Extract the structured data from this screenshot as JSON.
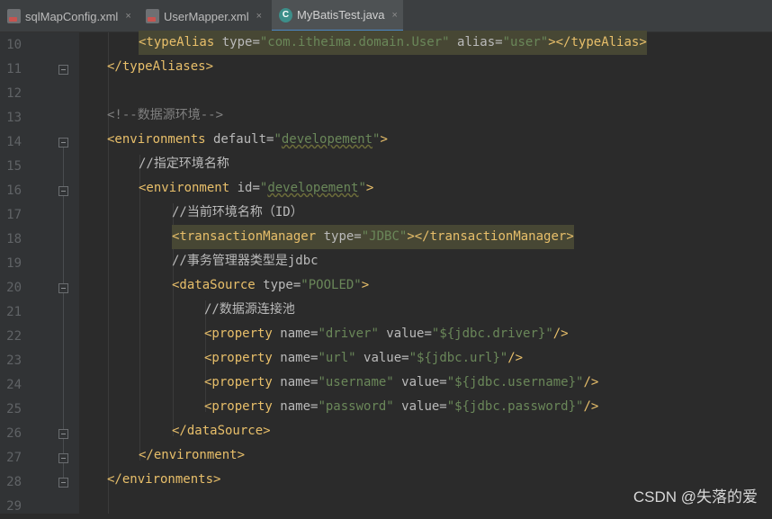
{
  "tabs": [
    {
      "label": "sqlMapConfig.xml",
      "icon": "xml-file-icon",
      "active": false
    },
    {
      "label": "UserMapper.xml",
      "icon": "xml-file-icon",
      "active": false
    },
    {
      "label": "MyBatisTest.java",
      "icon": "java-class-icon",
      "active": true
    }
  ],
  "close_glyph": "×",
  "line_numbers": [
    "10",
    "11",
    "12",
    "13",
    "14",
    "15",
    "16",
    "17",
    "18",
    "19",
    "20",
    "21",
    "22",
    "23",
    "24",
    "25",
    "26",
    "27",
    "28",
    "29"
  ],
  "code": {
    "l10": {
      "a": "<typeAlias",
      "b": " type=",
      "c": "\"com.itheima.domain.User\"",
      "d": " alias=",
      "e": "\"user\"",
      "f": "></typeAlias>"
    },
    "l11": {
      "a": "</typeAliases>"
    },
    "l13": {
      "a": "<!--数据源环境-->"
    },
    "l14": {
      "a": "<environments",
      "b": " default=",
      "c": "\"",
      "d": "developement",
      "e": "\"",
      "f": ">"
    },
    "l15": {
      "a": "//指定环境名称"
    },
    "l16": {
      "a": "<environment",
      "b": " id=",
      "c": "\"",
      "d": "developement",
      "e": "\"",
      "f": ">"
    },
    "l17": {
      "a": "//当前环境名称（ID）"
    },
    "l18": {
      "a": "<transactionManager",
      "b": " type=",
      "c": "\"JDBC\"",
      "d": "></transactionManager>"
    },
    "l19": {
      "a": "//事务管理器类型是jdbc"
    },
    "l20": {
      "a": "<dataSource",
      "b": " type=",
      "c": "\"POOLED\"",
      "d": ">"
    },
    "l21": {
      "a": "//数据源连接池"
    },
    "l22": {
      "a": "<property",
      "b": " name=",
      "c": "\"driver\"",
      "d": " value=",
      "e": "\"${jdbc.driver}\"",
      "f": "/>"
    },
    "l23": {
      "a": "<property",
      "b": " name=",
      "c": "\"url\"",
      "d": " value=",
      "e": "\"${jdbc.url}\"",
      "f": "/>"
    },
    "l24": {
      "a": "<property",
      "b": " name=",
      "c": "\"username\"",
      "d": " value=",
      "e": "\"${jdbc.username}\"",
      "f": "/>"
    },
    "l25": {
      "a": "<property",
      "b": " name=",
      "c": "\"password\"",
      "d": " value=",
      "e": "\"${jdbc.password}\"",
      "f": "/>"
    },
    "l26": {
      "a": "</dataSource>"
    },
    "l27": {
      "a": "</environment>"
    },
    "l28": {
      "a": "</environments>"
    }
  },
  "watermark": "CSDN @失落的爱",
  "colors": {
    "tag": "#e8bf6a",
    "attr_name": "#bababa",
    "attr_value": "#6a8759",
    "comment": "#808080",
    "text": "#a9b7c6",
    "background": "#2b2b2b"
  }
}
